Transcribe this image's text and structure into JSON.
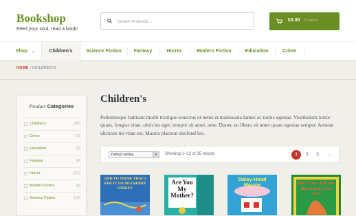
{
  "brand": {
    "name": "Bookshop",
    "tagline": "Feed your soul, read a book!"
  },
  "search": {
    "placeholder": "Search Products…"
  },
  "cart": {
    "amount": "£0.00",
    "count": "0 items"
  },
  "nav": [
    {
      "label": "Shop",
      "has_dropdown": true
    },
    {
      "label": "Children's",
      "active": true
    },
    {
      "label": "Science Fiction"
    },
    {
      "label": "Fantasy"
    },
    {
      "label": "Horror"
    },
    {
      "label": "Modern Fiction"
    },
    {
      "label": "Education"
    },
    {
      "label": "Crime"
    }
  ],
  "breadcrumb": {
    "home": "HOME",
    "separator": " / ",
    "current": "CHILDREN'S"
  },
  "sidebar": {
    "title_prefix": "Product",
    "title_suffix": " Categories",
    "categories": [
      {
        "name": "Children's",
        "count": "(35)"
      },
      {
        "name": "Crime",
        "count": "(1)"
      },
      {
        "name": "Education",
        "count": "(3)"
      },
      {
        "name": "Fantasy",
        "count": "(4)"
      },
      {
        "name": "Horror",
        "count": "(12)"
      },
      {
        "name": "Modern Fiction",
        "count": "(4)"
      },
      {
        "name": "Science Fiction",
        "count": "(10)"
      }
    ]
  },
  "main": {
    "title": "Children's",
    "description": "Pellentesque habitant morbi tristique senectus et netus et malesuada fames ac turpis egestas. Vestibulum tortor quam, feugiat vitae, ultricies eget, tempor sit amet, ante. Donec eu libero sit amet quam egestas semper. Aenean ultricies mi vitae est. Mauris placerat eleifend leo.",
    "sort_label": "Default sorting",
    "result_count": "Showing 1–12 of 35 results",
    "pagination": [
      "1",
      "2",
      "3",
      "→"
    ]
  },
  "products": [
    {
      "title": "AND TO THINK THAT I SAW IT ON MULBERRY STREET",
      "bg": "#2f6fb7"
    },
    {
      "title": "Are You My Mother?",
      "bg": "#2bb0a6"
    },
    {
      "title": "Daisy-Head Mayzie",
      "bg": "#33a3d6"
    },
    {
      "title": "Did I Ever Tell You How Lucky You Are?",
      "bg": "#1f8a3c"
    }
  ],
  "colors": {
    "brand_green": "#6a8e23",
    "accent_red": "#c0392b",
    "page_bg": "#f1efe9"
  }
}
